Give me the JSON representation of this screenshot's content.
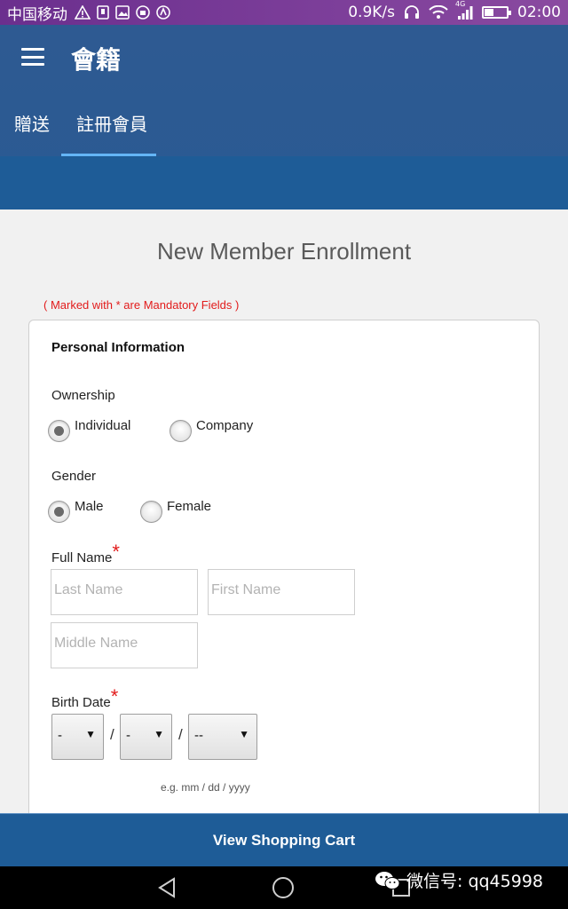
{
  "status_bar": {
    "carrier": "中国移动",
    "net_speed": "0.9K/s",
    "network_type": "4G",
    "time": "02:00",
    "battery_level": 0.4,
    "icons": [
      "alert-icon",
      "sim-icon",
      "image-icon",
      "shop-icon",
      "app-icon",
      "headset-icon",
      "wifi-icon",
      "signal-icon",
      "battery-icon"
    ]
  },
  "app_bar": {
    "title": "會籍",
    "tabs": [
      {
        "label": "贈送",
        "selected": false
      },
      {
        "label": "註冊會員",
        "selected": true
      }
    ],
    "colors": {
      "primary": "#2e5a92",
      "accent": "#64b5f6"
    }
  },
  "page": {
    "title": "New Member Enrollment",
    "mandatory_note": "( Marked with * are Mandatory Fields )"
  },
  "form": {
    "section_title": "Personal Information",
    "ownership": {
      "label": "Ownership",
      "options": [
        {
          "label": "Individual",
          "checked": true
        },
        {
          "label": "Company",
          "checked": false
        }
      ]
    },
    "gender": {
      "label": "Gender",
      "options": [
        {
          "label": "Male",
          "checked": true
        },
        {
          "label": "Female",
          "checked": false
        }
      ]
    },
    "full_name": {
      "label": "Full Name",
      "required_mark": "*",
      "last_name_placeholder": "Last Name",
      "first_name_placeholder": "First Name",
      "middle_name_placeholder": "Middle Name"
    },
    "birth_date": {
      "label": "Birth Date",
      "required_mark": "*",
      "month_value": "-",
      "day_value": "-",
      "year_value": "--",
      "separator": "/",
      "hint": "e.g. mm / dd / yyyy"
    }
  },
  "cart_bar": {
    "label": "View Shopping Cart"
  },
  "watermark": {
    "text": "微信号: qq45998"
  }
}
